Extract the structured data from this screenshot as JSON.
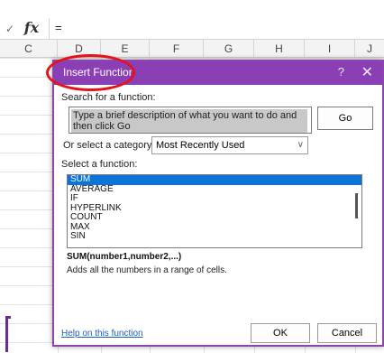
{
  "formula_bar": {
    "fx_label": "fx",
    "cancel_glyph": "✓",
    "value": "="
  },
  "columns": [
    "C",
    "D",
    "E",
    "F",
    "G",
    "H",
    "I",
    "J"
  ],
  "dialog": {
    "title": "Insert Function",
    "help_glyph": "?",
    "close_glyph": "✕",
    "search_label": "Search for a function:",
    "search_text": "Type a brief description of what you want to do and then click Go",
    "go_label": "Go",
    "category_label": "Or select a category:",
    "category_value": "Most Recently Used",
    "function_list_label": "Select a function:",
    "functions": [
      "SUM",
      "AVERAGE",
      "IF",
      "HYPERLINK",
      "COUNT",
      "MAX",
      "SIN"
    ],
    "selected_function": "SUM",
    "signature": "SUM(number1,number2,...)",
    "description": "Adds all the numbers in a range of cells.",
    "help_link": "Help on this function",
    "ok_label": "OK",
    "cancel_label": "Cancel"
  },
  "colors": {
    "accent": "#8a3fb5",
    "selection": "#0a74da",
    "highlight_circle": "#e4121b"
  }
}
